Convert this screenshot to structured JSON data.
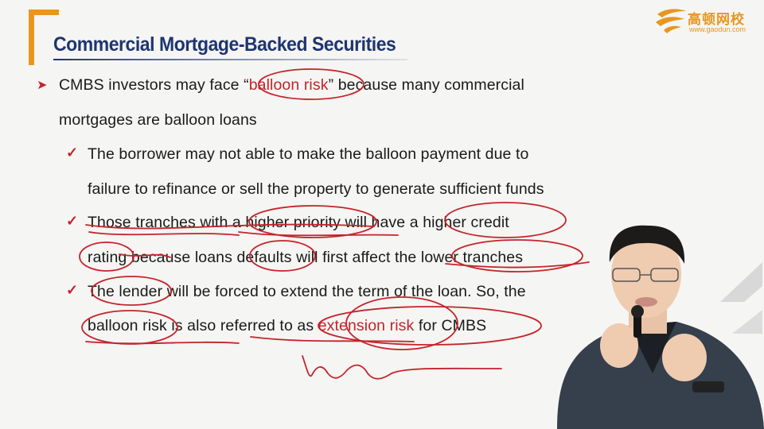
{
  "slide": {
    "title": "Commercial Mortgage-Backed Securities",
    "logo": {
      "name_cn": "高顿网校",
      "url": "www.gaodun.com"
    },
    "point1": {
      "pre": "CMBS investors may face “",
      "highlight": "balloon risk",
      "post": "” because many commercial",
      "line2": "mortgages are balloon loans"
    },
    "sub1": {
      "line1": "The borrower may not able to make the balloon payment due to",
      "line2": "failure to refinance or sell the property to generate sufficient funds"
    },
    "sub2": {
      "line1": "Those tranches with a higher priority will have a higher credit",
      "line2": "rating because loans defaults will first affect the lower tranches"
    },
    "sub3": {
      "line1": "The lender will be forced to extend the term of the loan. So, the",
      "line2_pre": "balloon risk is also referred to as ",
      "line2_highlight": "extension risk",
      "line2_post": " for CMBS"
    },
    "colors": {
      "title": "#1f3570",
      "accent": "#e8961e",
      "annotation": "#c4242b"
    }
  }
}
